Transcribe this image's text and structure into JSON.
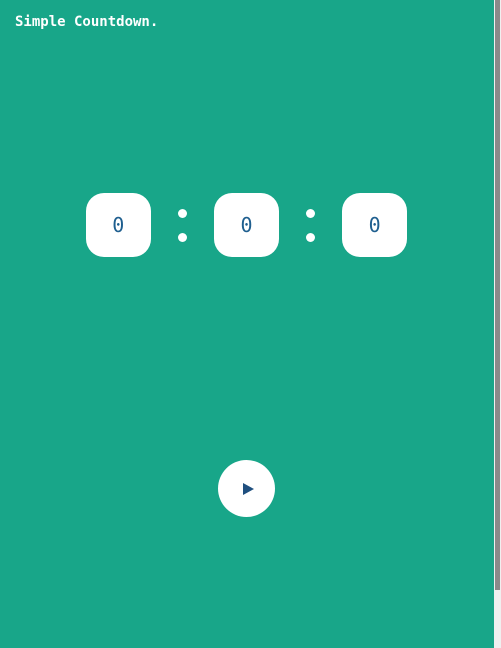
{
  "app": {
    "title": "Simple Countdown."
  },
  "timer": {
    "hours": "0",
    "minutes": "0",
    "seconds": "0"
  },
  "controls": {
    "play_icon": "play-icon"
  },
  "colors": {
    "background": "#18a689",
    "box": "#ffffff",
    "digit": "#1f5f8f"
  }
}
